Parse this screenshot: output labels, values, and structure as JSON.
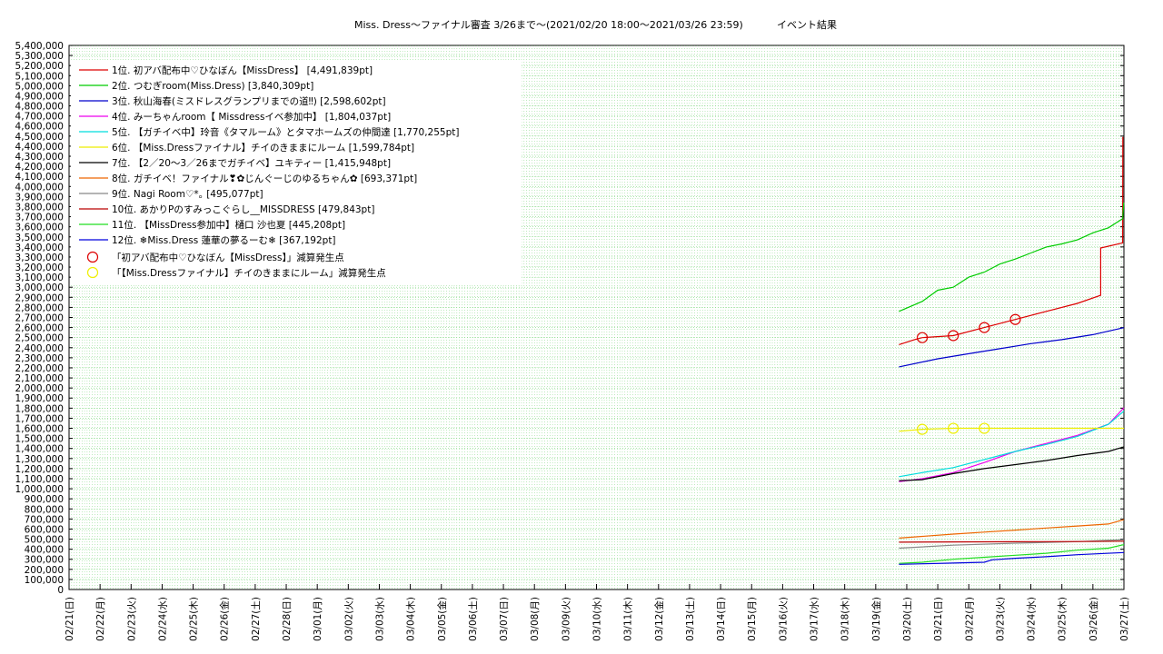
{
  "chart_data": {
    "type": "line",
    "title": "Miss. Dress〜ファイナル審査 3/26まで〜(2021/02/20 18:00〜2021/03/26 23:59)",
    "subtitle": "イベント結果",
    "x_tick_labels": [
      "02/21(日)",
      "02/22(月)",
      "02/23(火)",
      "02/24(水)",
      "02/25(木)",
      "02/26(金)",
      "02/27(土)",
      "02/28(日)",
      "03/01(月)",
      "03/02(火)",
      "03/03(水)",
      "03/04(木)",
      "03/05(金)",
      "03/06(土)",
      "03/07(日)",
      "03/08(月)",
      "03/09(火)",
      "03/10(水)",
      "03/11(木)",
      "03/12(金)",
      "03/13(土)",
      "03/14(日)",
      "03/15(月)",
      "03/16(火)",
      "03/17(水)",
      "03/18(木)",
      "03/19(金)",
      "03/20(土)",
      "03/21(日)",
      "03/22(月)",
      "03/23(火)",
      "03/24(水)",
      "03/25(木)",
      "03/26(金)",
      "03/27(土)"
    ],
    "y_tick_labels": [
      "0",
      "100,000",
      "200,000",
      "300,000",
      "400,000",
      "500,000",
      "600,000",
      "700,000",
      "800,000",
      "900,000",
      "1,000,000",
      "1,100,000",
      "1,200,000",
      "1,300,000",
      "1,400,000",
      "1,500,000",
      "1,600,000",
      "1,700,000",
      "1,800,000",
      "1,900,000",
      "2,000,000",
      "2,100,000",
      "2,200,000",
      "2,300,000",
      "2,400,000",
      "2,500,000",
      "2,600,000",
      "2,700,000",
      "2,800,000",
      "2,900,000",
      "3,000,000",
      "3,100,000",
      "3,200,000",
      "3,300,000",
      "3,400,000",
      "3,500,000",
      "3,600,000",
      "3,700,000",
      "3,800,000",
      "3,900,000",
      "4,000,000",
      "4,100,000",
      "4,200,000",
      "4,300,000",
      "4,400,000",
      "4,500,000",
      "4,600,000",
      "4,700,000",
      "4,800,000",
      "4,900,000",
      "5,000,000",
      "5,100,000",
      "5,200,000",
      "5,300,000",
      "5,400,000"
    ],
    "xlim": [
      "2021-02-21",
      "2021-03-27"
    ],
    "ylim": [
      0,
      5400000
    ],
    "grid": true,
    "legend_position": "top-left",
    "series": [
      {
        "name": "1位. 初アバ配布中♡ひなぼん【MissDress】 [4,491,839pt]",
        "color": "#dd0000",
        "points": [
          [
            "2021-03-19 18:00",
            2430000
          ],
          [
            "2021-03-20 06:00",
            2480000
          ],
          [
            "2021-03-20 12:00",
            2500000
          ],
          [
            "2021-03-21 12:00",
            2520000
          ],
          [
            "2021-03-22 12:00",
            2600000
          ],
          [
            "2021-03-23 12:00",
            2680000
          ],
          [
            "2021-03-24 12:00",
            2760000
          ],
          [
            "2021-03-25 12:00",
            2840000
          ],
          [
            "2021-03-26 06:00",
            2920000
          ],
          [
            "2021-03-26 06:00",
            3390000
          ],
          [
            "2021-03-26 23:00",
            3440000
          ],
          [
            "2021-03-26 23:10",
            4491839
          ]
        ]
      },
      {
        "name": "2位. つむぎroom(Miss.Dress) [3,840,309pt]",
        "color": "#00cc00",
        "points": [
          [
            "2021-03-19 18:00",
            2760000
          ],
          [
            "2021-03-20 12:00",
            2860000
          ],
          [
            "2021-03-21 00:00",
            2970000
          ],
          [
            "2021-03-21 12:00",
            3000000
          ],
          [
            "2021-03-22 00:00",
            3100000
          ],
          [
            "2021-03-22 12:00",
            3150000
          ],
          [
            "2021-03-23 00:00",
            3230000
          ],
          [
            "2021-03-23 12:00",
            3280000
          ],
          [
            "2021-03-24 00:00",
            3340000
          ],
          [
            "2021-03-24 12:00",
            3400000
          ],
          [
            "2021-03-25 00:00",
            3430000
          ],
          [
            "2021-03-25 12:00",
            3470000
          ],
          [
            "2021-03-26 00:00",
            3540000
          ],
          [
            "2021-03-26 12:00",
            3590000
          ],
          [
            "2021-03-26 23:00",
            3680000
          ],
          [
            "2021-03-26 23:50",
            3840309
          ]
        ]
      },
      {
        "name": "3位. 秋山海春(ミスドレスグランプリまでの道‼︎) [2,598,602pt]",
        "color": "#0000cc",
        "points": [
          [
            "2021-03-19 18:00",
            2210000
          ],
          [
            "2021-03-21 00:00",
            2290000
          ],
          [
            "2021-03-22 00:00",
            2340000
          ],
          [
            "2021-03-23 00:00",
            2390000
          ],
          [
            "2021-03-24 00:00",
            2440000
          ],
          [
            "2021-03-25 00:00",
            2480000
          ],
          [
            "2021-03-26 00:00",
            2530000
          ],
          [
            "2021-03-26 23:59",
            2598602
          ]
        ]
      },
      {
        "name": "4位. みーちゃんroom【 Missdressイベ参加中】 [1,804,037pt]",
        "color": "#ee00ee",
        "points": [
          [
            "2021-03-19 18:00",
            1070000
          ],
          [
            "2021-03-20 12:00",
            1100000
          ],
          [
            "2021-03-21 12:00",
            1160000
          ],
          [
            "2021-03-22 12:00",
            1260000
          ],
          [
            "2021-03-23 12:00",
            1370000
          ],
          [
            "2021-03-24 12:00",
            1450000
          ],
          [
            "2021-03-25 12:00",
            1530000
          ],
          [
            "2021-03-26 12:00",
            1640000
          ],
          [
            "2021-03-26 23:59",
            1804037
          ]
        ]
      },
      {
        "name": "5位. 【ガチイベ中】玲音《タマルーム》とタマホームズの仲間達 [1,770,255pt]",
        "color": "#00dddd",
        "points": [
          [
            "2021-03-19 18:00",
            1120000
          ],
          [
            "2021-03-20 12:00",
            1160000
          ],
          [
            "2021-03-21 12:00",
            1210000
          ],
          [
            "2021-03-22 12:00",
            1290000
          ],
          [
            "2021-03-23 12:00",
            1370000
          ],
          [
            "2021-03-24 12:00",
            1440000
          ],
          [
            "2021-03-25 12:00",
            1520000
          ],
          [
            "2021-03-26 12:00",
            1640000
          ],
          [
            "2021-03-26 23:59",
            1770255
          ]
        ]
      },
      {
        "name": "6位. 【Miss.Dressファイナル】チイのきままにルーム [1,599,784pt]",
        "color": "#eeee00",
        "points": [
          [
            "2021-03-19 18:00",
            1570000
          ],
          [
            "2021-03-20 12:00",
            1590000
          ],
          [
            "2021-03-21 12:00",
            1599784
          ],
          [
            "2021-03-26 23:59",
            1599784
          ]
        ]
      },
      {
        "name": "7位. 【2／20〜3／26までガチイベ】ユキティー [1,415,948pt]",
        "color": "#000000",
        "points": [
          [
            "2021-03-19 18:00",
            1080000
          ],
          [
            "2021-03-20 12:00",
            1090000
          ],
          [
            "2021-03-21 12:00",
            1150000
          ],
          [
            "2021-03-22 12:00",
            1200000
          ],
          [
            "2021-03-23 12:00",
            1240000
          ],
          [
            "2021-03-24 12:00",
            1280000
          ],
          [
            "2021-03-25 12:00",
            1330000
          ],
          [
            "2021-03-26 12:00",
            1370000
          ],
          [
            "2021-03-26 23:59",
            1415948
          ]
        ]
      },
      {
        "name": "8位. ガチイベ！ファイナル❣✿じんぐーじのゆるちゃん✿ [693,371pt]",
        "color": "#ee6600",
        "points": [
          [
            "2021-03-19 18:00",
            510000
          ],
          [
            "2021-03-21 12:00",
            550000
          ],
          [
            "2021-03-22 12:00",
            570000
          ],
          [
            "2021-03-23 12:00",
            590000
          ],
          [
            "2021-03-24 12:00",
            610000
          ],
          [
            "2021-03-25 12:00",
            630000
          ],
          [
            "2021-03-26 12:00",
            650000
          ],
          [
            "2021-03-26 23:59",
            693371
          ]
        ]
      },
      {
        "name": "9位. Nagi Room♡*｡ [495,077pt]",
        "color": "#888888",
        "points": [
          [
            "2021-03-19 18:00",
            410000
          ],
          [
            "2021-03-21 12:00",
            440000
          ],
          [
            "2021-03-23 12:00",
            460000
          ],
          [
            "2021-03-25 12:00",
            475000
          ],
          [
            "2021-03-26 23:59",
            495077
          ]
        ]
      },
      {
        "name": "10位. あかりPのすみっこぐらし__MISSDRESS [479,843pt]",
        "color": "#bb0000",
        "points": [
          [
            "2021-03-19 18:00",
            470000
          ],
          [
            "2021-03-21 12:00",
            472000
          ],
          [
            "2021-03-23 12:00",
            474000
          ],
          [
            "2021-03-25 12:00",
            476000
          ],
          [
            "2021-03-26 23:59",
            479843
          ]
        ]
      },
      {
        "name": "11位. 【MissDress参加中】樋口 沙也夏 [445,208pt]",
        "color": "#22dd22",
        "points": [
          [
            "2021-03-19 18:00",
            260000
          ],
          [
            "2021-03-20 12:00",
            270000
          ],
          [
            "2021-03-21 12:00",
            300000
          ],
          [
            "2021-03-22 12:00",
            320000
          ],
          [
            "2021-03-23 12:00",
            340000
          ],
          [
            "2021-03-24 12:00",
            360000
          ],
          [
            "2021-03-25 12:00",
            390000
          ],
          [
            "2021-03-26 12:00",
            410000
          ],
          [
            "2021-03-26 23:59",
            445208
          ]
        ]
      },
      {
        "name": "12位. ❄Miss.Dress 蓮華の夢るーむ❄ [367,192pt]",
        "color": "#0000dd",
        "points": [
          [
            "2021-03-19 18:00",
            250000
          ],
          [
            "2021-03-20 12:00",
            255000
          ],
          [
            "2021-03-21 12:00",
            262000
          ],
          [
            "2021-03-22 12:00",
            270000
          ],
          [
            "2021-03-22 18:00",
            295000
          ],
          [
            "2021-03-23 12:00",
            310000
          ],
          [
            "2021-03-24 12:00",
            325000
          ],
          [
            "2021-03-25 12:00",
            345000
          ],
          [
            "2021-03-26 23:59",
            367192
          ]
        ]
      }
    ],
    "markers": [
      {
        "name": "「初アバ配布中♡ひなぼん【MissDress】」減算発生点",
        "color": "#dd0000",
        "points": [
          [
            "2021-03-20 12:00",
            2500000
          ],
          [
            "2021-03-21 12:00",
            2520000
          ],
          [
            "2021-03-22 12:00",
            2600000
          ],
          [
            "2021-03-23 12:00",
            2680000
          ]
        ]
      },
      {
        "name": "「【Miss.Dressファイナル】チイのきままにルーム」減算発生点",
        "color": "#eeee00",
        "points": [
          [
            "2021-03-20 12:00",
            1590000
          ],
          [
            "2021-03-21 12:00",
            1599784
          ],
          [
            "2021-03-22 12:00",
            1599784
          ]
        ]
      }
    ]
  }
}
